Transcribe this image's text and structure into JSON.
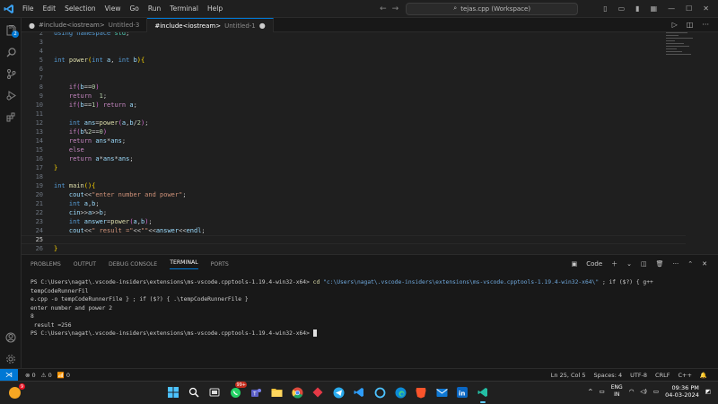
{
  "titlebar": {
    "menu": [
      "File",
      "Edit",
      "Selection",
      "View",
      "Go",
      "Run",
      "Terminal",
      "Help"
    ],
    "search_text": "tejas.cpp (Workspace)"
  },
  "tabs": [
    {
      "name": "#include<iostream>",
      "sub": "Untitled-3",
      "active": false
    },
    {
      "name": "#include<iostream>",
      "sub": "Untitled-1",
      "active": true
    }
  ],
  "activity_badge": "2",
  "editor": {
    "lines": [
      {
        "n": "2",
        "text": "using namespace std;"
      },
      {
        "n": "3",
        "text": ""
      },
      {
        "n": "4",
        "text": ""
      },
      {
        "n": "5",
        "text": "int power(int a, int b){"
      },
      {
        "n": "6",
        "text": ""
      },
      {
        "n": "7",
        "text": ""
      },
      {
        "n": "8",
        "text": "    if(b==0)"
      },
      {
        "n": "9",
        "text": "    return  1;"
      },
      {
        "n": "10",
        "text": "    if(b==1) return a;"
      },
      {
        "n": "11",
        "text": ""
      },
      {
        "n": "12",
        "text": "    int ans=power(a,b/2);"
      },
      {
        "n": "13",
        "text": "    if(b%2==0)"
      },
      {
        "n": "14",
        "text": "    return ans*ans;"
      },
      {
        "n": "15",
        "text": "    else"
      },
      {
        "n": "16",
        "text": "    return a*ans*ans;"
      },
      {
        "n": "17",
        "text": "}"
      },
      {
        "n": "18",
        "text": ""
      },
      {
        "n": "19",
        "text": "int main(){"
      },
      {
        "n": "20",
        "text": "    cout<<\"enter number and power\";"
      },
      {
        "n": "21",
        "text": "    int a,b;"
      },
      {
        "n": "22",
        "text": "    cin>>a>>b;"
      },
      {
        "n": "23",
        "text": "    int answer=power(a,b);"
      },
      {
        "n": "24",
        "text": "    cout<<\" result =\"<<\"\"<<answer<<endl;"
      },
      {
        "n": "25",
        "text": ""
      },
      {
        "n": "26",
        "text": "}"
      }
    ]
  },
  "panel": {
    "tabs": [
      "PROBLEMS",
      "OUTPUT",
      "DEBUG CONSOLE",
      "TERMINAL",
      "PORTS"
    ],
    "active_tab": "TERMINAL",
    "shell_label": "Code",
    "terminal": {
      "prompt1": "PS C:\\Users\\nagat\\.vscode-insiders\\extensions\\ms-vscode.cpptools-1.19.4-win32-x64>",
      "cmd1_cd": "cd",
      "cmd1_path": "\"c:\\Users\\nagat\\.vscode-insiders\\extensions\\ms-vscode.cpptools-1.19.4-win32-x64\\\"",
      "cmd1_rest": "; if ($?) { g++ tempCodeRunnerFil",
      "cmd1_wrap": "e.cpp -o tempCodeRunnerFile } ; if ($?) { .\\tempCodeRunnerFile }",
      "out1": "enter number and power 2",
      "out2": "8",
      "out3": " result =256",
      "prompt2": "PS C:\\Users\\nagat\\.vscode-insiders\\extensions\\ms-vscode.cpptools-1.19.4-win32-x64>"
    }
  },
  "statusbar": {
    "errors": "0",
    "warnings": "0",
    "info": "0",
    "position": "Ln 25, Col 5",
    "spaces": "Spaces: 4",
    "encoding": "UTF-8",
    "eol": "CRLF",
    "language": "C++"
  },
  "taskbar": {
    "weather_badge": "9",
    "whatsapp_badge": "99+",
    "lang_top": "ENG",
    "lang_bottom": "IN",
    "time": "09:36 PM",
    "date": "04-03-2024"
  }
}
